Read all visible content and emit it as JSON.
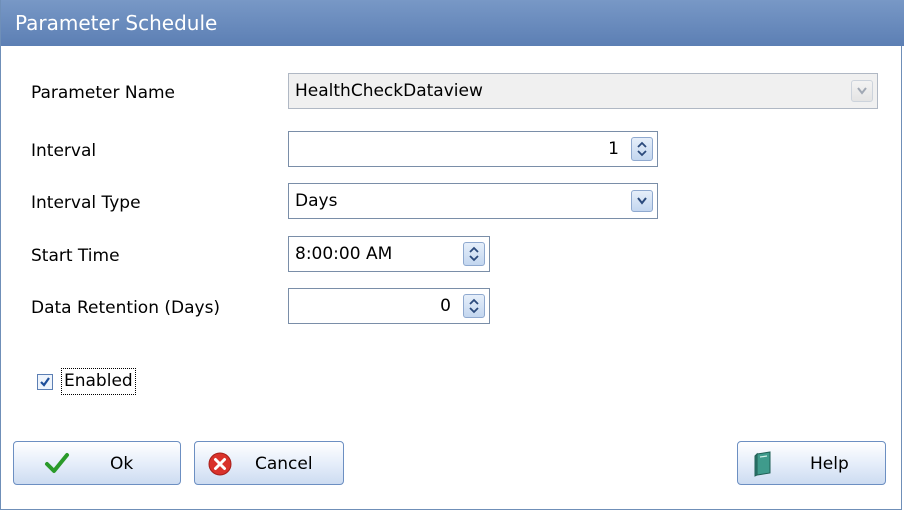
{
  "window": {
    "title": "Parameter Schedule"
  },
  "form": {
    "parameter_name": {
      "label": "Parameter Name",
      "value": "HealthCheckDataview",
      "enabled": false
    },
    "interval": {
      "label": "Interval",
      "value": "1"
    },
    "interval_type": {
      "label": "Interval Type",
      "value": "Days"
    },
    "start_time": {
      "label": "Start Time",
      "value": "8:00:00 AM"
    },
    "data_retention": {
      "label": "Data Retention (Days)",
      "value": "0"
    },
    "enabled": {
      "label": "Enabled",
      "checked": true
    }
  },
  "buttons": {
    "ok": {
      "label": "Ok",
      "icon": "checkmark-icon"
    },
    "cancel": {
      "label": "Cancel",
      "icon": "cancel-icon"
    },
    "help": {
      "label": "Help",
      "icon": "help-book-icon"
    }
  },
  "colors": {
    "titlebar": "#6788bc",
    "button_border": "#6c8fc2",
    "ok_check": "#2a9a2a",
    "cancel_red": "#d9322b",
    "help_book": "#3f9b8c"
  }
}
